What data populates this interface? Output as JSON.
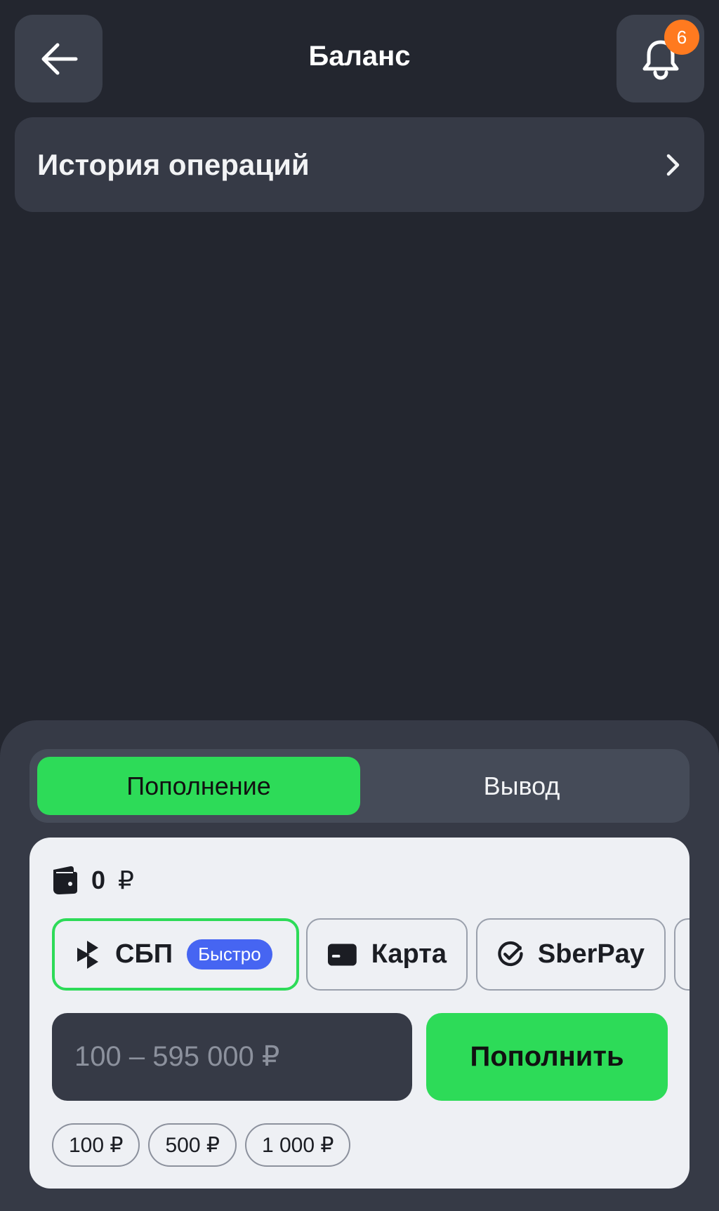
{
  "header": {
    "title": "Баланс",
    "back_icon": "arrow-left-icon",
    "bell_icon": "bell-icon",
    "notification_count": "6"
  },
  "history": {
    "label": "История операций",
    "chevron_icon": "chevron-right-icon"
  },
  "tabs": [
    {
      "label": "Пополнение",
      "active": true
    },
    {
      "label": "Вывод",
      "active": false
    }
  ],
  "balance": {
    "value": "0",
    "currency": "₽",
    "icon": "wallet-icon"
  },
  "methods": [
    {
      "label": "СБП",
      "badge": "Быстро",
      "icon": "sbp-icon",
      "selected": true
    },
    {
      "label": "Карта",
      "icon": "card-icon",
      "selected": false
    },
    {
      "label": "SberPay",
      "icon": "sberpay-icon",
      "selected": false
    }
  ],
  "amount": {
    "placeholder": "100 – 595 000 ₽",
    "value": ""
  },
  "submit_label": "Пополнить",
  "presets": [
    "100 ₽",
    "500 ₽",
    "1 000 ₽"
  ],
  "colors": {
    "background": "#23262f",
    "surface": "#363a46",
    "accent_green": "#2ddb58",
    "badge_orange": "#ff7a1f",
    "fast_badge_blue": "#4665f2",
    "card_bg": "#eef0f4"
  }
}
